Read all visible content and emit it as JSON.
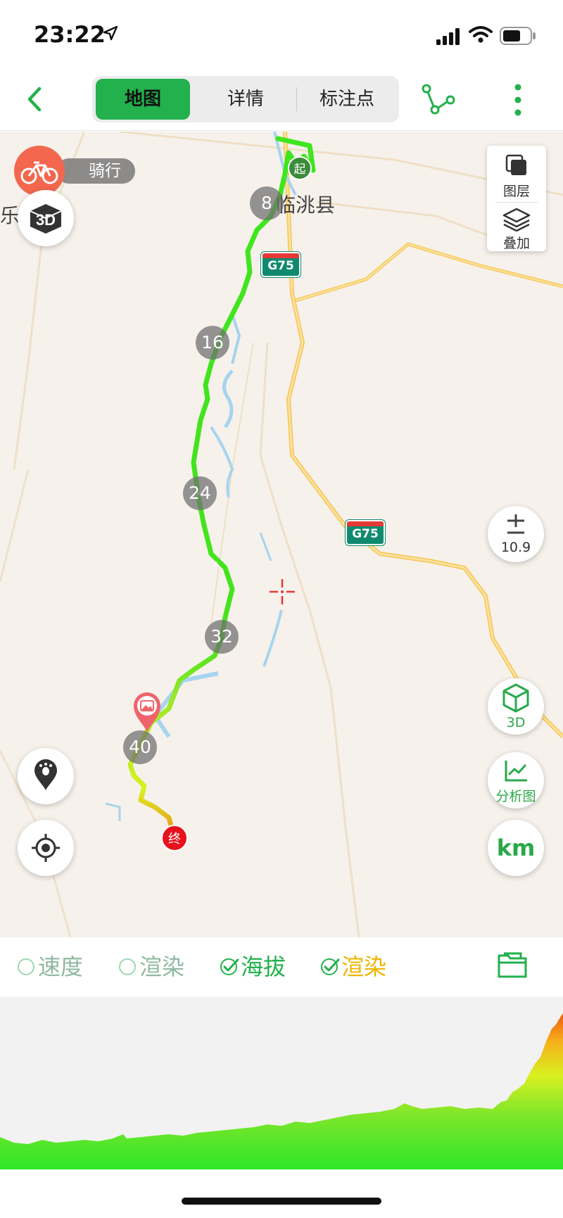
{
  "status_bar": {
    "time": "23:22"
  },
  "nav": {
    "tabs": [
      {
        "label": "地图",
        "active": true
      },
      {
        "label": "详情",
        "active": false
      },
      {
        "label": "标注点",
        "active": false
      }
    ]
  },
  "map": {
    "mode_label": "骑行",
    "place_labels": {
      "county": "临洮县",
      "partial_left": "乐"
    },
    "highway_shield": "G75",
    "start_label": "起",
    "end_label": "终",
    "km_markers": [
      "8",
      "16",
      "24",
      "32",
      "40"
    ],
    "layers_label": "图层",
    "overlay_label": "叠加",
    "zoom_level": "10.9",
    "threed_label": "3D",
    "analysis_label": "分析图",
    "unit_label": "km",
    "colors": {
      "track_green": "#3ee61e",
      "accent_green": "#22b14c",
      "track_yellow": "#d8f020",
      "track_orange": "#f08a1a"
    }
  },
  "toggles": [
    {
      "label": "速度",
      "checked": false
    },
    {
      "label": "渲染",
      "checked": false
    },
    {
      "label": "海拔",
      "checked": true
    },
    {
      "label": "渲染",
      "checked": true
    }
  ],
  "elevation_chart": {
    "type": "area",
    "shows_relative_profile": true
  }
}
